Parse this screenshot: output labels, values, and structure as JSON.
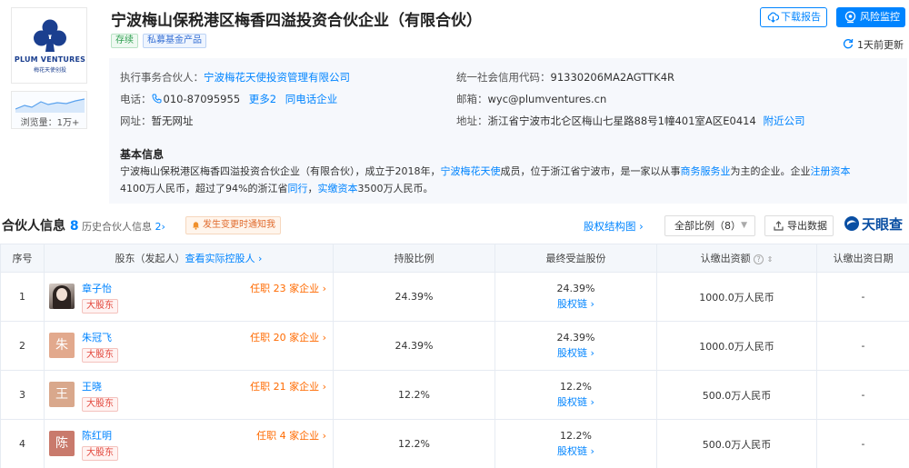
{
  "company": {
    "name": "宁波梅山保税港区梅香四溢投资合伙企业（有限合伙）",
    "tags": [
      "存续",
      "私募基金产品"
    ],
    "logo_text_1": "PLUM VENTURES",
    "logo_text_2": "梅花天使创投"
  },
  "actions": {
    "report_label": "下载报告",
    "risk_label": "风险监控",
    "update_label": "1天前更新"
  },
  "trend": {
    "views": "浏览量：1万+"
  },
  "info": {
    "partner_key": "执行事务合伙人：",
    "partner_val": "宁波梅花天使投资管理有限公司",
    "credit_key": "统一社会信用代码：",
    "credit_val": "91330206MA2AGTTK4R",
    "phone_key": "电话：",
    "phone_val": "010-87095955",
    "phone_more": "更多2",
    "phone_same": "同电话企业",
    "email_key": "邮箱：",
    "email_val": "wyc@plumventures.cn",
    "site_key": "网址：",
    "site_val": "暂无网址",
    "addr_key": "地址：",
    "addr_val": "浙江省宁波市北仑区梅山七星路88号1幢401室A区E0414",
    "addr_near": "附近公司"
  },
  "basic": {
    "title": "基本信息",
    "p1": "宁波梅山保税港区梅香四溢投资合伙企业（有限合伙），成立于2018年，",
    "l1": "宁波梅花天使",
    "p2": "成员，位于浙江省宁波市，是一家以从事",
    "l2": "商务服务业",
    "p3": "为主的企业。企业",
    "l3": "注册资本",
    "p4": "4100万人民币，超过了94%的浙江省",
    "l4": "同行",
    "p5": "，",
    "l5": "实缴资本",
    "p6": "3500万人民币。"
  },
  "section": {
    "title": "合伙人信息",
    "count": "8",
    "history_label": "历史合伙人信息",
    "history_count": "2",
    "notify_label": "发生变更时通知我",
    "equity_label": "股权结构图",
    "ratio_label": "全部比例（8）",
    "export_label": "导出数据",
    "brand": "天眼查"
  },
  "table": {
    "headers": {
      "no": "序号",
      "holder": "股东（发起人）",
      "holder_link": "查看实际控股人",
      "ratio": "持股比例",
      "final": "最终受益股份",
      "sub": "认缴出资额",
      "date": "认缴出资日期"
    },
    "rows": [
      {
        "no": "1",
        "avatar": "",
        "name": "章子怡",
        "badge": "大股东",
        "roles": "任职 23 家企业",
        "ratio": "24.39%",
        "final": "24.39%",
        "chain": "股权链",
        "sub": "1000.0万人民币",
        "date": "-"
      },
      {
        "no": "2",
        "avatar": "朱",
        "name": "朱冠飞",
        "badge": "大股东",
        "roles": "任职 20 家企业",
        "ratio": "24.39%",
        "final": "24.39%",
        "chain": "股权链",
        "sub": "1000.0万人民币",
        "date": "-"
      },
      {
        "no": "3",
        "avatar": "王",
        "name": "王晓",
        "badge": "大股东",
        "roles": "任职 21 家企业",
        "ratio": "12.2%",
        "final": "12.2%",
        "chain": "股权链",
        "sub": "500.0万人民币",
        "date": "-"
      },
      {
        "no": "4",
        "avatar": "陈",
        "name": "陈红明",
        "badge": "大股东",
        "roles": "任职 4 家企业",
        "ratio": "12.2%",
        "final": "12.2%",
        "chain": "股权链",
        "sub": "500.0万人民币",
        "date": "-"
      }
    ]
  },
  "colors": {
    "accent": "#0084ff",
    "avatar_2": "#e2a98d",
    "avatar_3": "#d9a88c",
    "avatar_4": "#c97a6c"
  }
}
